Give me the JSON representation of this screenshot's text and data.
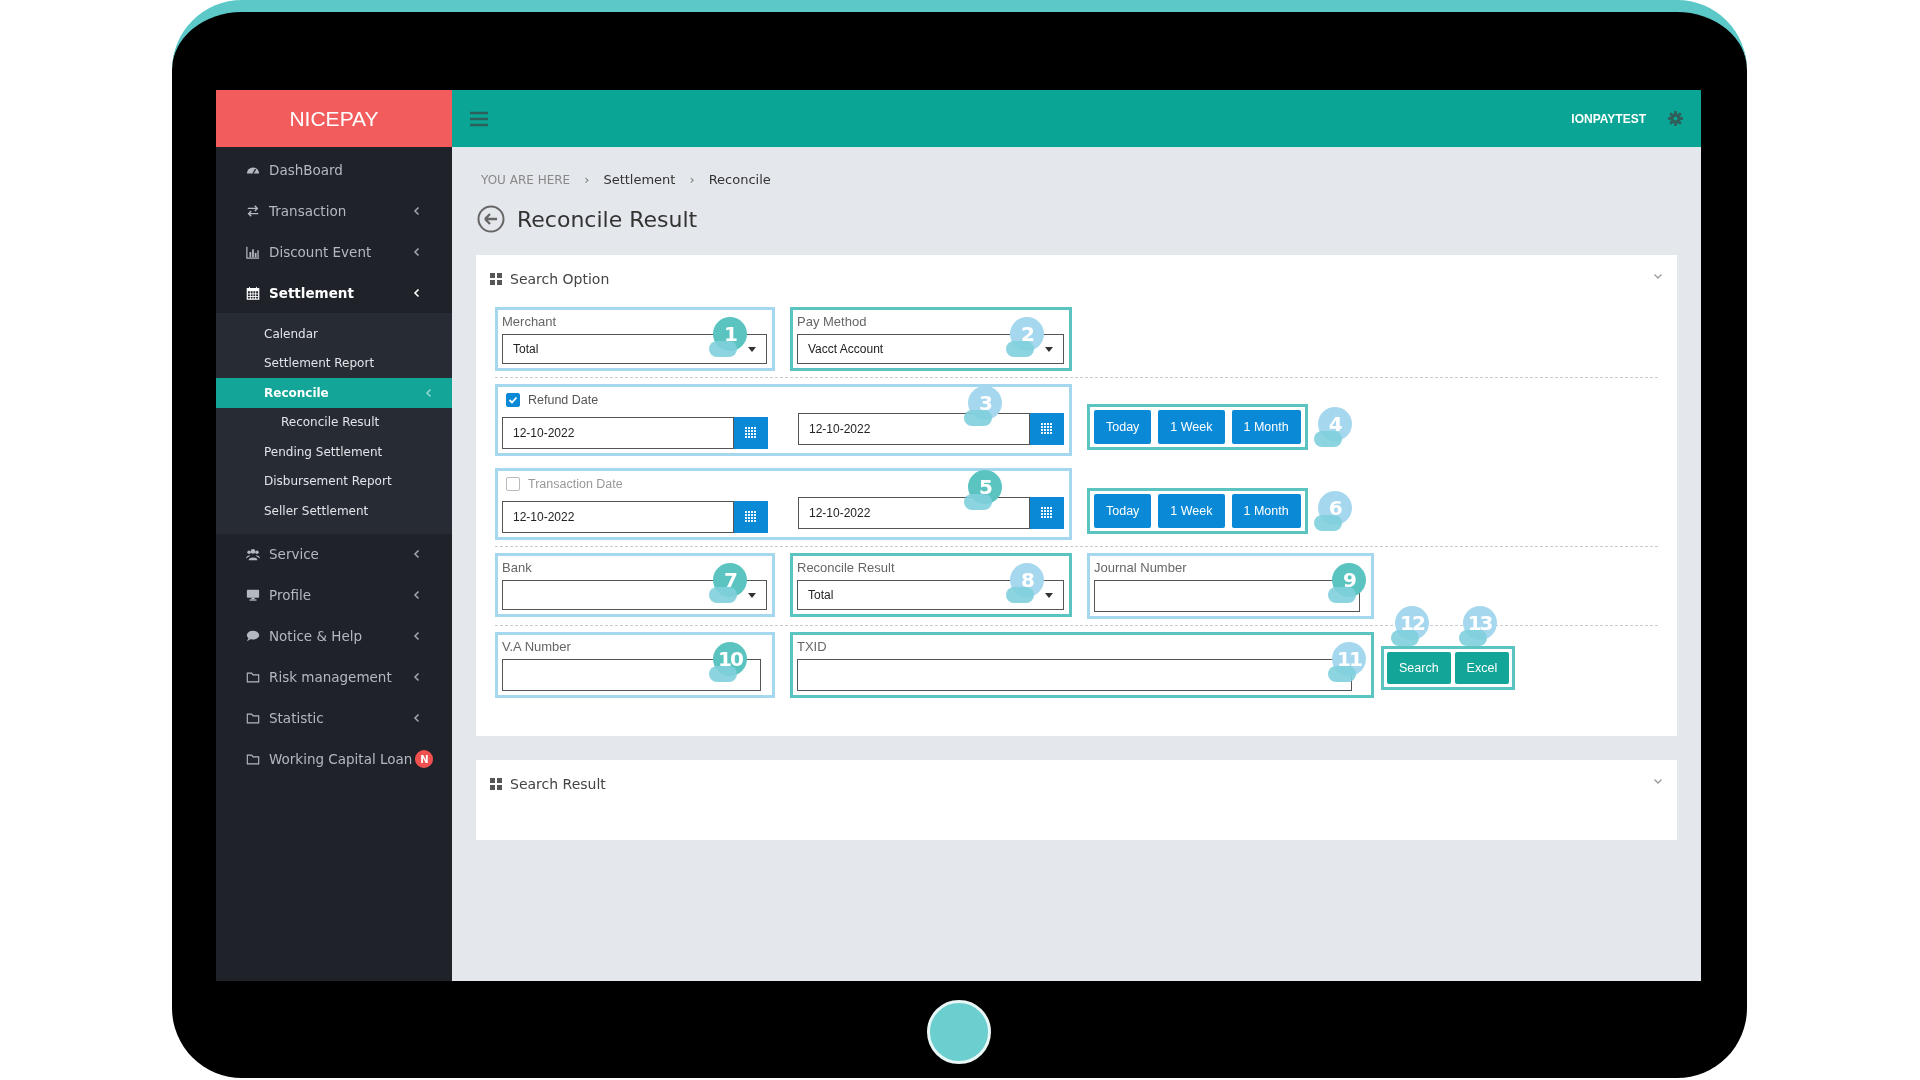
{
  "sidebar": {
    "logo": "NICEPAY",
    "items": [
      {
        "label": "DashBoard",
        "selected": false
      },
      {
        "label": "Transaction",
        "selected": false,
        "expanded": false
      },
      {
        "label": "Discount Event",
        "selected": false,
        "expanded": false
      },
      {
        "label": "Settlement",
        "selected": true,
        "expanded": true,
        "children": [
          {
            "label": "Calendar",
            "selected": false
          },
          {
            "label": "Settlement Report",
            "selected": false
          },
          {
            "label": "Reconcile",
            "selected": true,
            "expanded": true,
            "children": [
              {
                "label": "Reconcile Result",
                "selected": false
              }
            ]
          },
          {
            "label": "Pending Settlement",
            "selected": false
          },
          {
            "label": "Disbursement Report",
            "selected": false
          },
          {
            "label": "Seller Settlement",
            "selected": false
          }
        ]
      },
      {
        "label": "Service",
        "selected": false,
        "expanded": false
      },
      {
        "label": "Profile",
        "selected": false,
        "expanded": false
      },
      {
        "label": "Notice & Help",
        "selected": false,
        "expanded": false
      },
      {
        "label": "Risk management",
        "selected": false,
        "expanded": false
      },
      {
        "label": "Statistic",
        "selected": false,
        "expanded": false
      },
      {
        "label": "Working Capital Loan",
        "selected": false,
        "badge": "N"
      }
    ]
  },
  "topbar": {
    "user": "IONPAYTEST"
  },
  "breadcrumb": {
    "lead": "YOU ARE HERE",
    "separator": "›",
    "items": [
      "Settlement",
      "Reconcile"
    ]
  },
  "page_title": "Reconcile Result",
  "search_option": {
    "title": "Search Option",
    "rows": [
      {
        "separated": true,
        "items": [
          {
            "kind": "select",
            "label": "Merchant",
            "value": "Total",
            "color": "#a5d8ee",
            "callout": {
              "number": "1",
              "color": "#5bc4c0"
            }
          },
          {
            "kind": "select",
            "label": "Pay Method",
            "value": "Vacct Account",
            "color": "#5bc4c0",
            "callout": {
              "number": "2",
              "color": "#a5d8ee"
            }
          }
        ]
      },
      {
        "separated": false,
        "items": [
          {
            "kind": "daterange",
            "label": "Refund Date",
            "checked": true,
            "from": "12-10-2022",
            "to": "12-10-2022",
            "color": "#a5d8ee",
            "callout": {
              "number": "3",
              "color": "#a5d8ee"
            }
          },
          {
            "kind": "quick",
            "buttons": [
              "Today",
              "1 Week",
              "1 Month"
            ],
            "color": "#5bc4c0",
            "callout": {
              "number": "4",
              "color": "#a5d8ee"
            }
          }
        ]
      },
      {
        "separated": true,
        "items": [
          {
            "kind": "daterange",
            "label": "Transaction Date",
            "checked": false,
            "from": "12-10-2022",
            "to": "12-10-2022",
            "color": "#a5d8ee",
            "callout": {
              "number": "5",
              "color": "#5bc4c0"
            }
          },
          {
            "kind": "quick",
            "buttons": [
              "Today",
              "1 Week",
              "1 Month"
            ],
            "color": "#5bc4c0",
            "callout": {
              "number": "6",
              "color": "#a5d8ee"
            }
          }
        ]
      },
      {
        "separated": true,
        "items": [
          {
            "kind": "select",
            "label": "Bank",
            "color": "#a5d8ee",
            "callout": {
              "number": "7",
              "color": "#5bc4c0"
            }
          },
          {
            "kind": "select",
            "label": "Reconcile Result",
            "value": "Total",
            "color": "#5bc4c0",
            "callout": {
              "number": "8",
              "color": "#a5d8ee"
            }
          },
          {
            "kind": "text",
            "label": "Journal Number",
            "color": "#a5d8ee",
            "callout": {
              "number": "9",
              "color": "#5bc4c0"
            }
          }
        ]
      },
      {
        "separated": false,
        "items": [
          {
            "kind": "text",
            "label": "V.A Number",
            "color": "#a5d8ee",
            "callout": {
              "number": "10",
              "color": "#5bc4c0"
            }
          },
          {
            "kind": "longtext",
            "label": "TXID",
            "color": "#5bc4c0",
            "callout": {
              "number": "11",
              "color": "#a5d8ee"
            }
          },
          {
            "kind": "actions",
            "color": "#5bc4c0",
            "buttons": [
              {
                "label": "Search",
                "callout": {
                  "number": "12",
                  "color": "#a5d8ee"
                }
              },
              {
                "label": "Excel",
                "callout": {
                  "number": "13",
                  "color": "#a5d8ee"
                }
              }
            ]
          }
        ]
      }
    ]
  },
  "search_result": {
    "title": "Search Result"
  }
}
